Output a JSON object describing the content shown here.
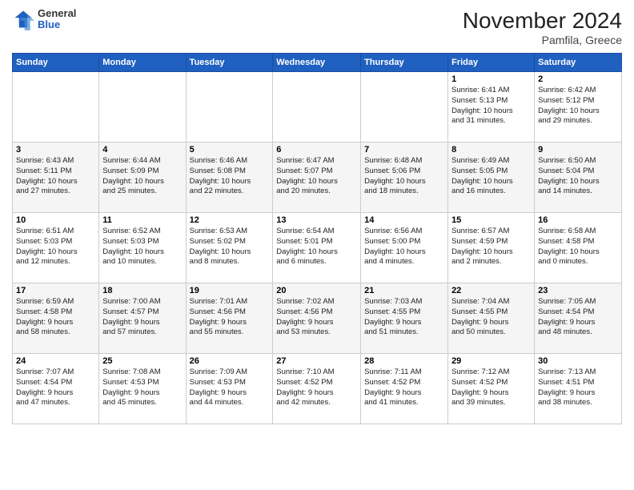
{
  "header": {
    "logo_general": "General",
    "logo_blue": "Blue",
    "month_title": "November 2024",
    "location": "Pamfila, Greece"
  },
  "weekdays": [
    "Sunday",
    "Monday",
    "Tuesday",
    "Wednesday",
    "Thursday",
    "Friday",
    "Saturday"
  ],
  "weeks": [
    [
      {
        "day": "",
        "info": ""
      },
      {
        "day": "",
        "info": ""
      },
      {
        "day": "",
        "info": ""
      },
      {
        "day": "",
        "info": ""
      },
      {
        "day": "",
        "info": ""
      },
      {
        "day": "1",
        "info": "Sunrise: 6:41 AM\nSunset: 5:13 PM\nDaylight: 10 hours\nand 31 minutes."
      },
      {
        "day": "2",
        "info": "Sunrise: 6:42 AM\nSunset: 5:12 PM\nDaylight: 10 hours\nand 29 minutes."
      }
    ],
    [
      {
        "day": "3",
        "info": "Sunrise: 6:43 AM\nSunset: 5:11 PM\nDaylight: 10 hours\nand 27 minutes."
      },
      {
        "day": "4",
        "info": "Sunrise: 6:44 AM\nSunset: 5:09 PM\nDaylight: 10 hours\nand 25 minutes."
      },
      {
        "day": "5",
        "info": "Sunrise: 6:46 AM\nSunset: 5:08 PM\nDaylight: 10 hours\nand 22 minutes."
      },
      {
        "day": "6",
        "info": "Sunrise: 6:47 AM\nSunset: 5:07 PM\nDaylight: 10 hours\nand 20 minutes."
      },
      {
        "day": "7",
        "info": "Sunrise: 6:48 AM\nSunset: 5:06 PM\nDaylight: 10 hours\nand 18 minutes."
      },
      {
        "day": "8",
        "info": "Sunrise: 6:49 AM\nSunset: 5:05 PM\nDaylight: 10 hours\nand 16 minutes."
      },
      {
        "day": "9",
        "info": "Sunrise: 6:50 AM\nSunset: 5:04 PM\nDaylight: 10 hours\nand 14 minutes."
      }
    ],
    [
      {
        "day": "10",
        "info": "Sunrise: 6:51 AM\nSunset: 5:03 PM\nDaylight: 10 hours\nand 12 minutes."
      },
      {
        "day": "11",
        "info": "Sunrise: 6:52 AM\nSunset: 5:03 PM\nDaylight: 10 hours\nand 10 minutes."
      },
      {
        "day": "12",
        "info": "Sunrise: 6:53 AM\nSunset: 5:02 PM\nDaylight: 10 hours\nand 8 minutes."
      },
      {
        "day": "13",
        "info": "Sunrise: 6:54 AM\nSunset: 5:01 PM\nDaylight: 10 hours\nand 6 minutes."
      },
      {
        "day": "14",
        "info": "Sunrise: 6:56 AM\nSunset: 5:00 PM\nDaylight: 10 hours\nand 4 minutes."
      },
      {
        "day": "15",
        "info": "Sunrise: 6:57 AM\nSunset: 4:59 PM\nDaylight: 10 hours\nand 2 minutes."
      },
      {
        "day": "16",
        "info": "Sunrise: 6:58 AM\nSunset: 4:58 PM\nDaylight: 10 hours\nand 0 minutes."
      }
    ],
    [
      {
        "day": "17",
        "info": "Sunrise: 6:59 AM\nSunset: 4:58 PM\nDaylight: 9 hours\nand 58 minutes."
      },
      {
        "day": "18",
        "info": "Sunrise: 7:00 AM\nSunset: 4:57 PM\nDaylight: 9 hours\nand 57 minutes."
      },
      {
        "day": "19",
        "info": "Sunrise: 7:01 AM\nSunset: 4:56 PM\nDaylight: 9 hours\nand 55 minutes."
      },
      {
        "day": "20",
        "info": "Sunrise: 7:02 AM\nSunset: 4:56 PM\nDaylight: 9 hours\nand 53 minutes."
      },
      {
        "day": "21",
        "info": "Sunrise: 7:03 AM\nSunset: 4:55 PM\nDaylight: 9 hours\nand 51 minutes."
      },
      {
        "day": "22",
        "info": "Sunrise: 7:04 AM\nSunset: 4:55 PM\nDaylight: 9 hours\nand 50 minutes."
      },
      {
        "day": "23",
        "info": "Sunrise: 7:05 AM\nSunset: 4:54 PM\nDaylight: 9 hours\nand 48 minutes."
      }
    ],
    [
      {
        "day": "24",
        "info": "Sunrise: 7:07 AM\nSunset: 4:54 PM\nDaylight: 9 hours\nand 47 minutes."
      },
      {
        "day": "25",
        "info": "Sunrise: 7:08 AM\nSunset: 4:53 PM\nDaylight: 9 hours\nand 45 minutes."
      },
      {
        "day": "26",
        "info": "Sunrise: 7:09 AM\nSunset: 4:53 PM\nDaylight: 9 hours\nand 44 minutes."
      },
      {
        "day": "27",
        "info": "Sunrise: 7:10 AM\nSunset: 4:52 PM\nDaylight: 9 hours\nand 42 minutes."
      },
      {
        "day": "28",
        "info": "Sunrise: 7:11 AM\nSunset: 4:52 PM\nDaylight: 9 hours\nand 41 minutes."
      },
      {
        "day": "29",
        "info": "Sunrise: 7:12 AM\nSunset: 4:52 PM\nDaylight: 9 hours\nand 39 minutes."
      },
      {
        "day": "30",
        "info": "Sunrise: 7:13 AM\nSunset: 4:51 PM\nDaylight: 9 hours\nand 38 minutes."
      }
    ]
  ]
}
